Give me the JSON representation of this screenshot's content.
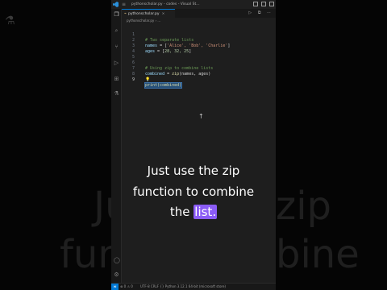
{
  "window": {
    "title": "pythonscholar.py - codes - Visual St..."
  },
  "tab": {
    "filename": "pythonscholar.py",
    "close_glyph": "×"
  },
  "breadcrumb": "pythonscholar.py › ...",
  "editor": {
    "lines": [
      {
        "num": "1",
        "comment": "# Two separate lists"
      },
      {
        "num": "2",
        "var": "names",
        "op": " = [",
        "items": "'Alice', 'Bob', 'Charlie'",
        "close": "]"
      },
      {
        "num": "3",
        "var": "ages",
        "op": " = [",
        "items": "28, 32, 25",
        "close": "]"
      },
      {
        "num": "4"
      },
      {
        "num": "5"
      },
      {
        "num": "6",
        "comment": "# Using zip to combine lists"
      },
      {
        "num": "7",
        "var": "combined",
        "op": " = ",
        "fn": "zip",
        "args": "(names, ages)"
      },
      {
        "num": "8"
      },
      {
        "num": "9",
        "selected": "print(combined)"
      }
    ]
  },
  "statusbar": {
    "left": "⊗ 0 ⚠ 0",
    "right": "UTF-8  CRLF  {} Python  3.12.1 64-bit (microsoft store)"
  },
  "caption": {
    "line1": "Just use the zip",
    "line2": "function to combine",
    "line3_prefix": "the ",
    "line3_highlight": "list.",
    "highlight_color": "#8b5cf6"
  },
  "background_caption": {
    "left_top": "Ju",
    "left_bottom": "func",
    "right_top": "zip",
    "right_bottom": "bine"
  },
  "icons": {
    "flask": "flask-icon",
    "vscode_logo": "vscode-logo-icon",
    "lightbulb": "lightbulb-icon"
  }
}
